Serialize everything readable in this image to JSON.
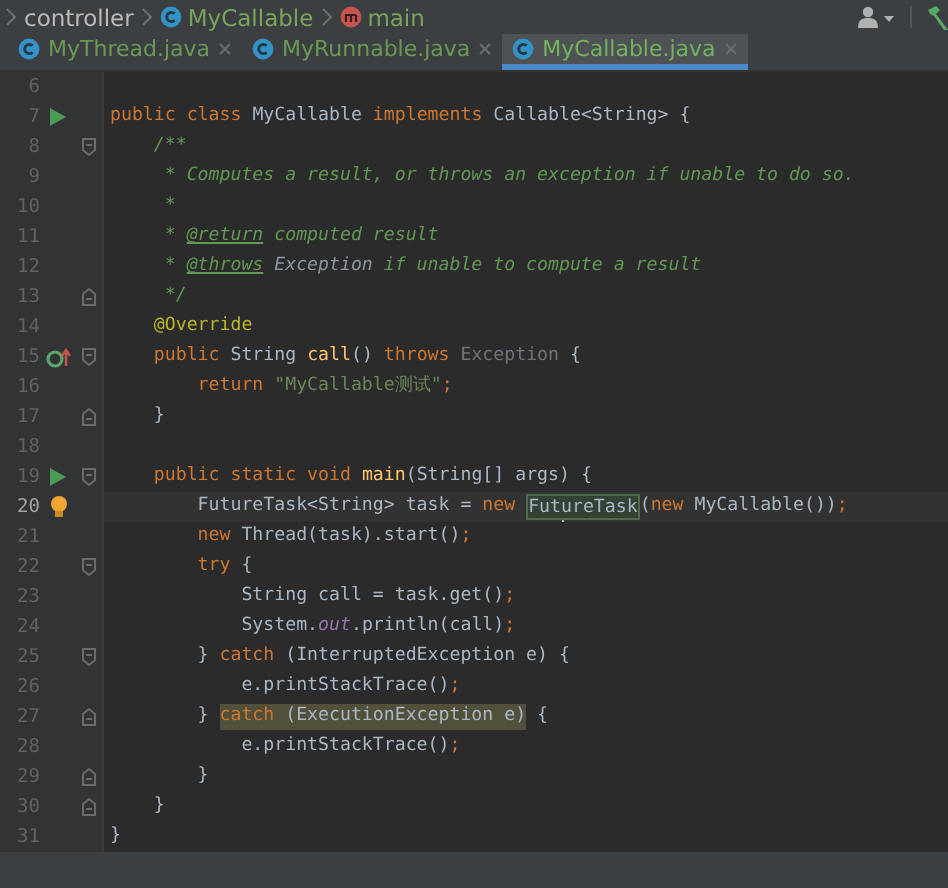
{
  "breadcrumbs": [
    {
      "label": "controller",
      "kind": "folder"
    },
    {
      "label": "MyCallable",
      "kind": "class"
    },
    {
      "label": "main",
      "kind": "method"
    }
  ],
  "tabs": [
    {
      "label": "MyThread.java",
      "selected": false
    },
    {
      "label": "MyRunnable.java",
      "selected": false
    },
    {
      "label": "MyCallable.java",
      "selected": true
    }
  ],
  "lines": [
    {
      "number": "6"
    },
    {
      "number": "7",
      "marker": {
        "kind": "run"
      },
      "tokens": [
        {
          "text": "public class ",
          "kind": "keyword"
        },
        {
          "text": "MyCallable ",
          "kind": "plain"
        },
        {
          "text": "implements ",
          "kind": "keyword"
        },
        {
          "text": "Callable<String> {",
          "kind": "plain"
        }
      ]
    },
    {
      "number": "8",
      "fold": {
        "kind": "start"
      },
      "tokens": [
        {
          "text": "    /**",
          "kind": "comment"
        }
      ]
    },
    {
      "number": "9",
      "tokens": [
        {
          "text": "     * Computes a result, or throws an exception if unable to do so.",
          "kind": "comment"
        }
      ]
    },
    {
      "number": "10",
      "tokens": [
        {
          "text": "     *",
          "kind": "comment"
        }
      ]
    },
    {
      "number": "11",
      "tokens": [
        {
          "text": "     * ",
          "kind": "comment"
        },
        {
          "text": "@return",
          "kind": "doc-tag"
        },
        {
          "text": " computed result",
          "kind": "comment"
        }
      ]
    },
    {
      "number": "12",
      "tokens": [
        {
          "text": "     * ",
          "kind": "comment"
        },
        {
          "text": "@throws",
          "kind": "doc-tag"
        },
        {
          "text": " Exception",
          "kind": "doc-ref"
        },
        {
          "text": " if unable to compute a result",
          "kind": "comment"
        }
      ]
    },
    {
      "number": "13",
      "fold": {
        "kind": "end"
      },
      "tokens": [
        {
          "text": "     */",
          "kind": "comment"
        }
      ]
    },
    {
      "number": "14",
      "tokens": [
        {
          "text": "    @Override",
          "kind": "annotation"
        }
      ]
    },
    {
      "number": "15",
      "marker": {
        "kind": "override"
      },
      "fold": {
        "kind": "start"
      },
      "tokens": [
        {
          "text": "    public ",
          "kind": "keyword"
        },
        {
          "text": "String ",
          "kind": "plain"
        },
        {
          "text": "call",
          "kind": "method"
        },
        {
          "text": "() ",
          "kind": "plain"
        },
        {
          "text": "throws ",
          "kind": "keyword"
        },
        {
          "text": "Exception ",
          "kind": "unused"
        },
        {
          "text": "{",
          "kind": "plain"
        }
      ]
    },
    {
      "number": "16",
      "tokens": [
        {
          "text": "        return ",
          "kind": "keyword"
        },
        {
          "text": "\"MyCallable测试\"",
          "kind": "string"
        },
        {
          "text": ";",
          "kind": "keyword"
        }
      ]
    },
    {
      "number": "17",
      "fold": {
        "kind": "end"
      },
      "tokens": [
        {
          "text": "    }",
          "kind": "plain"
        }
      ]
    },
    {
      "number": "18"
    },
    {
      "number": "19",
      "marker": {
        "kind": "run"
      },
      "fold": {
        "kind": "start"
      },
      "tokens": [
        {
          "text": "    public static void ",
          "kind": "keyword"
        },
        {
          "text": "main",
          "kind": "method"
        },
        {
          "text": "(String[] args) {",
          "kind": "plain"
        }
      ]
    },
    {
      "number": "20",
      "marker": {
        "kind": "bulb"
      },
      "current": true,
      "tokens": [
        {
          "text": "        FutureTask<String> task = ",
          "kind": "plain"
        },
        {
          "text": "new ",
          "kind": "keyword"
        },
        {
          "text": "Fut",
          "kind": "plain",
          "highlight": {
            "kind": "usage"
          },
          "caret": true
        },
        {
          "text": "ureTask",
          "kind": "plain",
          "highlight": {
            "kind": "usage"
          }
        },
        {
          "text": "(",
          "kind": "plain"
        },
        {
          "text": "new ",
          "kind": "keyword"
        },
        {
          "text": "MyCallable())",
          "kind": "plain"
        },
        {
          "text": ";",
          "kind": "keyword"
        }
      ]
    },
    {
      "number": "21",
      "tokens": [
        {
          "text": "        new ",
          "kind": "keyword"
        },
        {
          "text": "Thread(task).start()",
          "kind": "plain"
        },
        {
          "text": ";",
          "kind": "keyword"
        }
      ]
    },
    {
      "number": "22",
      "fold": {
        "kind": "start"
      },
      "tokens": [
        {
          "text": "        try ",
          "kind": "keyword"
        },
        {
          "text": "{",
          "kind": "plain"
        }
      ]
    },
    {
      "number": "23",
      "tokens": [
        {
          "text": "            String call = task.get()",
          "kind": "plain"
        },
        {
          "text": ";",
          "kind": "keyword"
        }
      ]
    },
    {
      "number": "24",
      "tokens": [
        {
          "text": "            System.",
          "kind": "plain"
        },
        {
          "text": "out",
          "kind": "static-field"
        },
        {
          "text": ".println(call)",
          "kind": "plain"
        },
        {
          "text": ";",
          "kind": "keyword"
        }
      ]
    },
    {
      "number": "25",
      "fold": {
        "kind": "start"
      },
      "tokens": [
        {
          "text": "        } ",
          "kind": "plain"
        },
        {
          "text": "catch ",
          "kind": "keyword"
        },
        {
          "text": "(InterruptedException e) {",
          "kind": "plain"
        }
      ]
    },
    {
      "number": "26",
      "tokens": [
        {
          "text": "            e.printStackTrace()",
          "kind": "plain"
        },
        {
          "text": ";",
          "kind": "keyword"
        }
      ]
    },
    {
      "number": "27",
      "fold": {
        "kind": "end"
      },
      "tokens": [
        {
          "text": "        } ",
          "kind": "plain"
        },
        {
          "text": "catch ",
          "kind": "keyword",
          "highlight": {
            "kind": "exit"
          }
        },
        {
          "text": "(ExecutionException e)",
          "kind": "plain",
          "highlight": {
            "kind": "exit"
          }
        },
        {
          "text": " {",
          "kind": "plain"
        }
      ]
    },
    {
      "number": "28",
      "tokens": [
        {
          "text": "            e.printStackTrace()",
          "kind": "plain"
        },
        {
          "text": ";",
          "kind": "keyword"
        }
      ]
    },
    {
      "number": "29",
      "fold": {
        "kind": "end"
      },
      "tokens": [
        {
          "text": "        }",
          "kind": "plain"
        }
      ]
    },
    {
      "number": "30",
      "fold": {
        "kind": "end"
      },
      "tokens": [
        {
          "text": "    }",
          "kind": "plain"
        }
      ]
    },
    {
      "number": "31",
      "tokens": [
        {
          "text": "}",
          "kind": "plain"
        }
      ]
    }
  ]
}
